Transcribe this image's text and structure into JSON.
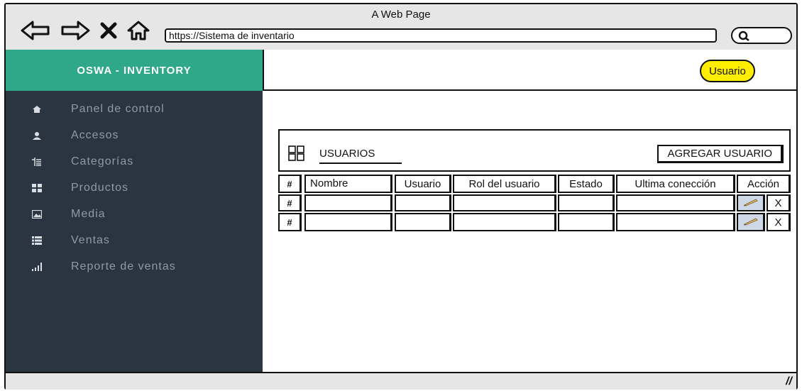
{
  "window": {
    "title": "A Web Page"
  },
  "browser": {
    "url": "https://Sistema de inventario",
    "nav_icons": [
      "back-arrow-icon",
      "forward-arrow-icon",
      "close-x-icon",
      "home-icon"
    ],
    "search_icon": "search-icon"
  },
  "brand": {
    "title": "OSWA - INVENTORY",
    "color": "#2fa88a"
  },
  "header": {
    "user_button": "Usuario",
    "user_button_color": "#ffee00"
  },
  "sidebar": {
    "background": "#2b3541",
    "items": [
      {
        "label": "Panel de control",
        "icon": "home-icon"
      },
      {
        "label": "Accesos",
        "icon": "user-icon"
      },
      {
        "label": "Categorías",
        "icon": "tree-list-icon"
      },
      {
        "label": "Productos",
        "icon": "grid-icon"
      },
      {
        "label": "Media",
        "icon": "image-icon"
      },
      {
        "label": "Ventas",
        "icon": "list-icon"
      },
      {
        "label": "Reporte de ventas",
        "icon": "signal-bars-icon"
      }
    ]
  },
  "panel": {
    "title": "USUARIOS",
    "icon": "grid-panel-icon",
    "add_button": "AGREGAR USUARIO"
  },
  "table": {
    "columns": [
      "#",
      "Nombre",
      "Usuario",
      "Rol del usuario",
      "Estado",
      "Ultima conección",
      "Acción"
    ],
    "rows": [
      {
        "index": "#",
        "nombre": "",
        "usuario": "",
        "rol": "",
        "estado": "",
        "ultima": "",
        "delete_label": "X",
        "edit_icon": "pencil-icon"
      },
      {
        "index": "#",
        "nombre": "",
        "usuario": "",
        "rol": "",
        "estado": "",
        "ultima": "",
        "delete_label": "X",
        "edit_icon": "pencil-icon"
      }
    ]
  }
}
